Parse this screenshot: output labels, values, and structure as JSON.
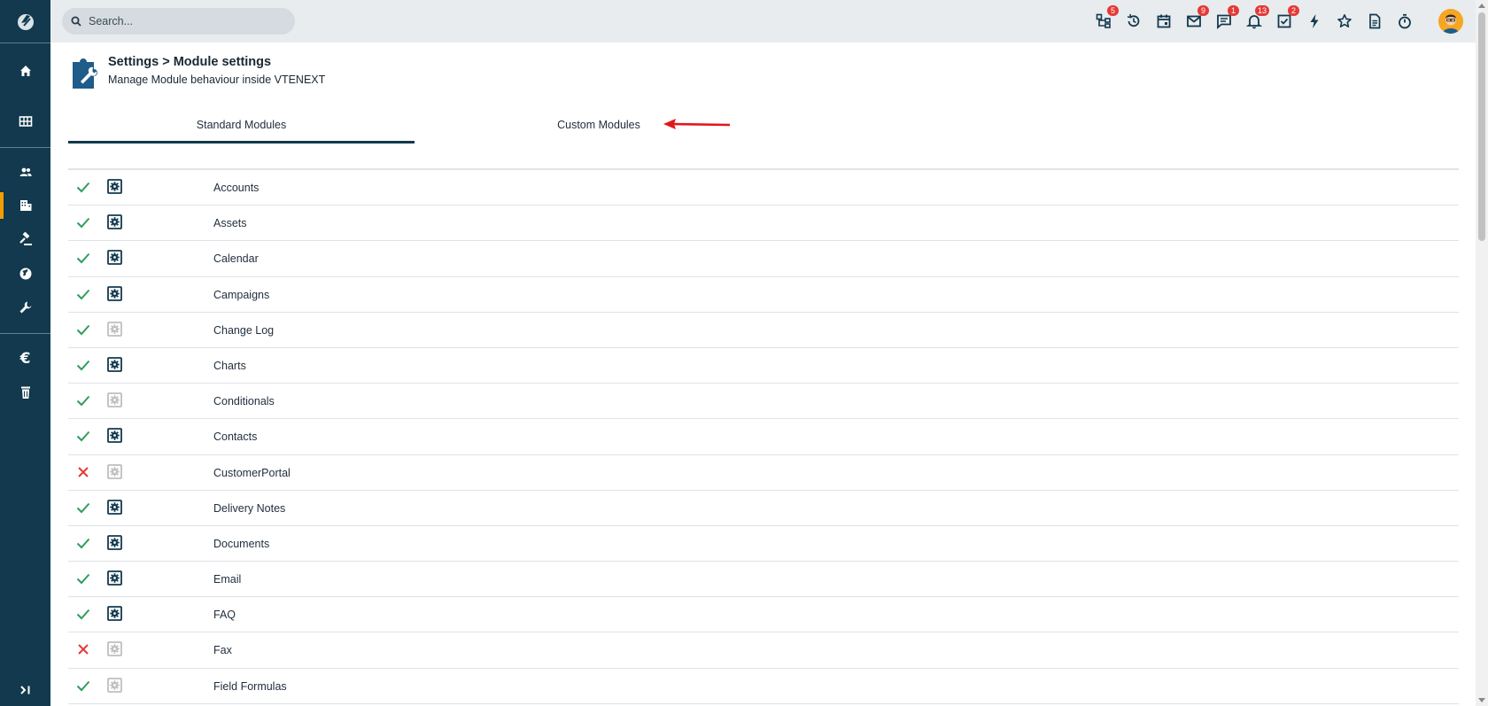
{
  "search": {
    "placeholder": "Search..."
  },
  "header": {
    "title": "Settings > Module settings",
    "subtitle": "Manage Module behaviour inside VTENEXT"
  },
  "tabs": [
    {
      "label": "Standard Modules",
      "active": true
    },
    {
      "label": "Custom Modules",
      "active": false
    }
  ],
  "topbar_icons": [
    {
      "name": "processes-icon",
      "badge": "5"
    },
    {
      "name": "history-icon",
      "badge": ""
    },
    {
      "name": "calendar-icon",
      "badge": ""
    },
    {
      "name": "mail-icon",
      "badge": "9"
    },
    {
      "name": "chat-icon",
      "badge": "1"
    },
    {
      "name": "bell-icon",
      "badge": "13"
    },
    {
      "name": "todo-icon",
      "badge": "2"
    },
    {
      "name": "lightning-icon",
      "badge": ""
    },
    {
      "name": "star-icon",
      "badge": ""
    },
    {
      "name": "document-icon",
      "badge": ""
    },
    {
      "name": "timer-icon",
      "badge": ""
    }
  ],
  "sidebar_icons": [
    "home-icon",
    "grid-icon",
    "users-icon",
    "building-icon",
    "gavel-icon",
    "globe-icon",
    "wrench-icon",
    "euro-icon",
    "trash-icon",
    "expand-icon"
  ],
  "modules": [
    {
      "name": "Accounts",
      "enabled": true,
      "configurable": true
    },
    {
      "name": "Assets",
      "enabled": true,
      "configurable": true
    },
    {
      "name": "Calendar",
      "enabled": true,
      "configurable": true
    },
    {
      "name": "Campaigns",
      "enabled": true,
      "configurable": true
    },
    {
      "name": "Change Log",
      "enabled": true,
      "configurable": false
    },
    {
      "name": "Charts",
      "enabled": true,
      "configurable": true
    },
    {
      "name": "Conditionals",
      "enabled": true,
      "configurable": false
    },
    {
      "name": "Contacts",
      "enabled": true,
      "configurable": true
    },
    {
      "name": "CustomerPortal",
      "enabled": false,
      "configurable": false
    },
    {
      "name": "Delivery Notes",
      "enabled": true,
      "configurable": true
    },
    {
      "name": "Documents",
      "enabled": true,
      "configurable": true
    },
    {
      "name": "Email",
      "enabled": true,
      "configurable": true
    },
    {
      "name": "FAQ",
      "enabled": true,
      "configurable": true
    },
    {
      "name": "Fax",
      "enabled": false,
      "configurable": false
    },
    {
      "name": "Field Formulas",
      "enabled": true,
      "configurable": false
    }
  ],
  "colors": {
    "sidebar": "#12394d",
    "accent": "#f59d00",
    "enabled": "#2e9e5b",
    "disabled": "#e53935",
    "settings_active": "#12394d",
    "settings_inactive": "#bfbfbf",
    "badge": "#e53935"
  }
}
